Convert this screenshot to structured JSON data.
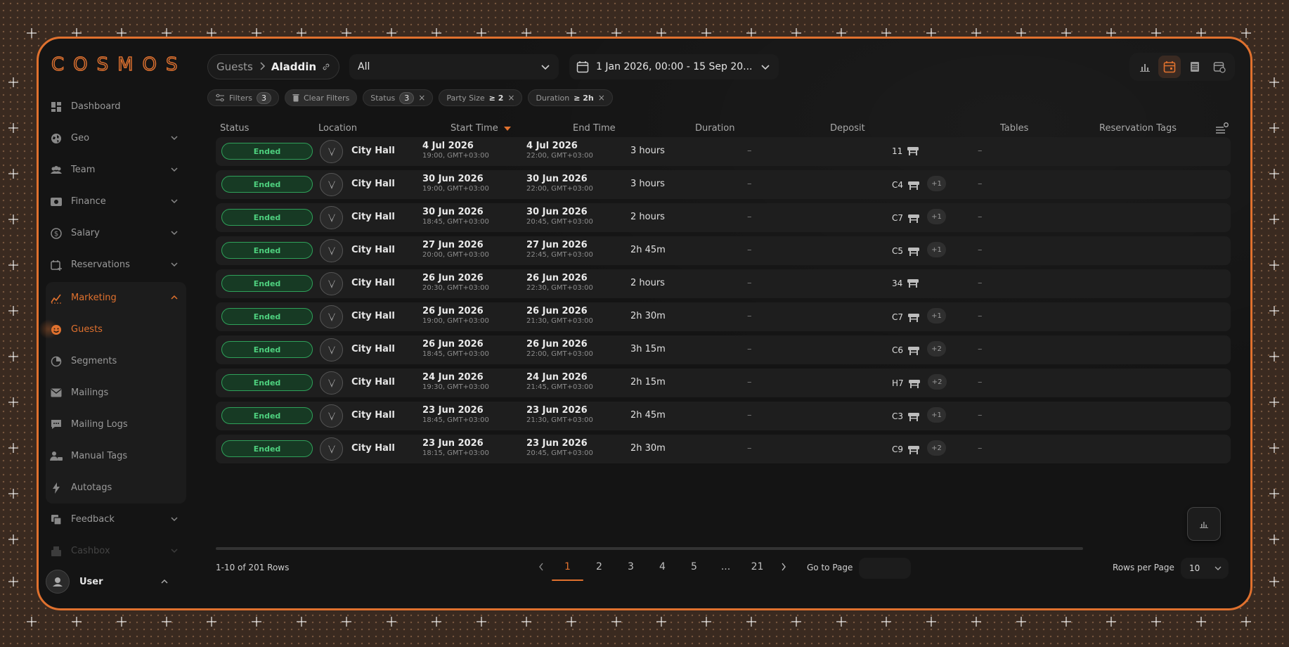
{
  "brand": {
    "logo_text": "COSMOS",
    "accent": "#e0712e"
  },
  "sidebar": {
    "items": [
      {
        "label": "Dashboard",
        "icon": "dashboard-icon",
        "expandable": false
      },
      {
        "label": "Geo",
        "icon": "globe-icon",
        "expandable": true
      },
      {
        "label": "Team",
        "icon": "team-icon",
        "expandable": true
      },
      {
        "label": "Finance",
        "icon": "finance-icon",
        "expandable": true
      },
      {
        "label": "Salary",
        "icon": "salary-icon",
        "expandable": true
      },
      {
        "label": "Reservations",
        "icon": "calendar-plus-icon",
        "expandable": true
      }
    ],
    "marketing": {
      "label": "Marketing",
      "sub_items": [
        "Guests",
        "Segments",
        "Mailings",
        "Mailing Logs",
        "Manual Tags",
        "Autotags"
      ]
    },
    "after": [
      {
        "label": "Feedback"
      },
      {
        "label": "Cashbox"
      }
    ],
    "user": {
      "name": "User"
    }
  },
  "breadcrumb": {
    "first": "Guests",
    "last": "Aladdin"
  },
  "location_select": {
    "value": "All"
  },
  "date_range": {
    "value": "1 Jan 2026, 00:00 - 15 Sep 20..."
  },
  "filters": {
    "filters_label": "Filters",
    "filters_count": "3",
    "clear_label": "Clear Filters",
    "status_label": "Status",
    "status_count": "3",
    "party_label": "Party Size",
    "party_value": "≥ 2",
    "duration_label": "Duration",
    "duration_value": "≥ 2h"
  },
  "table": {
    "headers": {
      "status": "Status",
      "location": "Location",
      "start": "Start Time",
      "end": "End Time",
      "duration": "Duration",
      "deposit": "Deposit",
      "tables": "Tables",
      "tags": "Reservation Tags"
    },
    "rows": [
      {
        "status": "Ended",
        "location": "City Hall",
        "start_date": "4 Jul 2026",
        "start_time": "19:00, GMT+03:00",
        "end_date": "4 Jul 2026",
        "end_time": "22:00, GMT+03:00",
        "duration": "3 hours",
        "deposit": "–",
        "table": "11",
        "more": "",
        "tags": "–"
      },
      {
        "status": "Ended",
        "location": "City Hall",
        "start_date": "30 Jun 2026",
        "start_time": "19:00, GMT+03:00",
        "end_date": "30 Jun 2026",
        "end_time": "22:00, GMT+03:00",
        "duration": "3 hours",
        "deposit": "–",
        "table": "C4",
        "more": "+1",
        "tags": "–"
      },
      {
        "status": "Ended",
        "location": "City Hall",
        "start_date": "30 Jun 2026",
        "start_time": "18:45, GMT+03:00",
        "end_date": "30 Jun 2026",
        "end_time": "20:45, GMT+03:00",
        "duration": "2 hours",
        "deposit": "–",
        "table": "C7",
        "more": "+1",
        "tags": "–"
      },
      {
        "status": "Ended",
        "location": "City Hall",
        "start_date": "27 Jun 2026",
        "start_time": "20:00, GMT+03:00",
        "end_date": "27 Jun 2026",
        "end_time": "22:45, GMT+03:00",
        "duration": "2h 45m",
        "deposit": "–",
        "table": "C5",
        "more": "+1",
        "tags": "–"
      },
      {
        "status": "Ended",
        "location": "City Hall",
        "start_date": "26 Jun 2026",
        "start_time": "20:30, GMT+03:00",
        "end_date": "26 Jun 2026",
        "end_time": "22:30, GMT+03:00",
        "duration": "2 hours",
        "deposit": "–",
        "table": "34",
        "more": "",
        "tags": "–"
      },
      {
        "status": "Ended",
        "location": "City Hall",
        "start_date": "26 Jun 2026",
        "start_time": "19:00, GMT+03:00",
        "end_date": "26 Jun 2026",
        "end_time": "21:30, GMT+03:00",
        "duration": "2h 30m",
        "deposit": "–",
        "table": "C7",
        "more": "+1",
        "tags": "–"
      },
      {
        "status": "Ended",
        "location": "City Hall",
        "start_date": "26 Jun 2026",
        "start_time": "18:45, GMT+03:00",
        "end_date": "26 Jun 2026",
        "end_time": "22:00, GMT+03:00",
        "duration": "3h 15m",
        "deposit": "–",
        "table": "C6",
        "more": "+2",
        "tags": "–"
      },
      {
        "status": "Ended",
        "location": "City Hall",
        "start_date": "24 Jun 2026",
        "start_time": "19:30, GMT+03:00",
        "end_date": "24 Jun 2026",
        "end_time": "21:45, GMT+03:00",
        "duration": "2h 15m",
        "deposit": "–",
        "table": "H7",
        "more": "+2",
        "tags": "–"
      },
      {
        "status": "Ended",
        "location": "City Hall",
        "start_date": "23 Jun 2026",
        "start_time": "18:45, GMT+03:00",
        "end_date": "23 Jun 2026",
        "end_time": "21:30, GMT+03:00",
        "duration": "2h 45m",
        "deposit": "–",
        "table": "C3",
        "more": "+1",
        "tags": "–"
      },
      {
        "status": "Ended",
        "location": "City Hall",
        "start_date": "23 Jun 2026",
        "start_time": "18:15, GMT+03:00",
        "end_date": "23 Jun 2026",
        "end_time": "20:45, GMT+03:00",
        "duration": "2h 30m",
        "deposit": "–",
        "table": "C9",
        "more": "+2",
        "tags": "–"
      }
    ]
  },
  "pagination": {
    "rows_info": "1-10 of 201 Rows",
    "pages": [
      "1",
      "2",
      "3",
      "4",
      "5",
      "...",
      "21"
    ],
    "current": "1",
    "goto_label": "Go to Page",
    "rows_per_page_label": "Rows per Page",
    "rows_per_page": "10"
  }
}
